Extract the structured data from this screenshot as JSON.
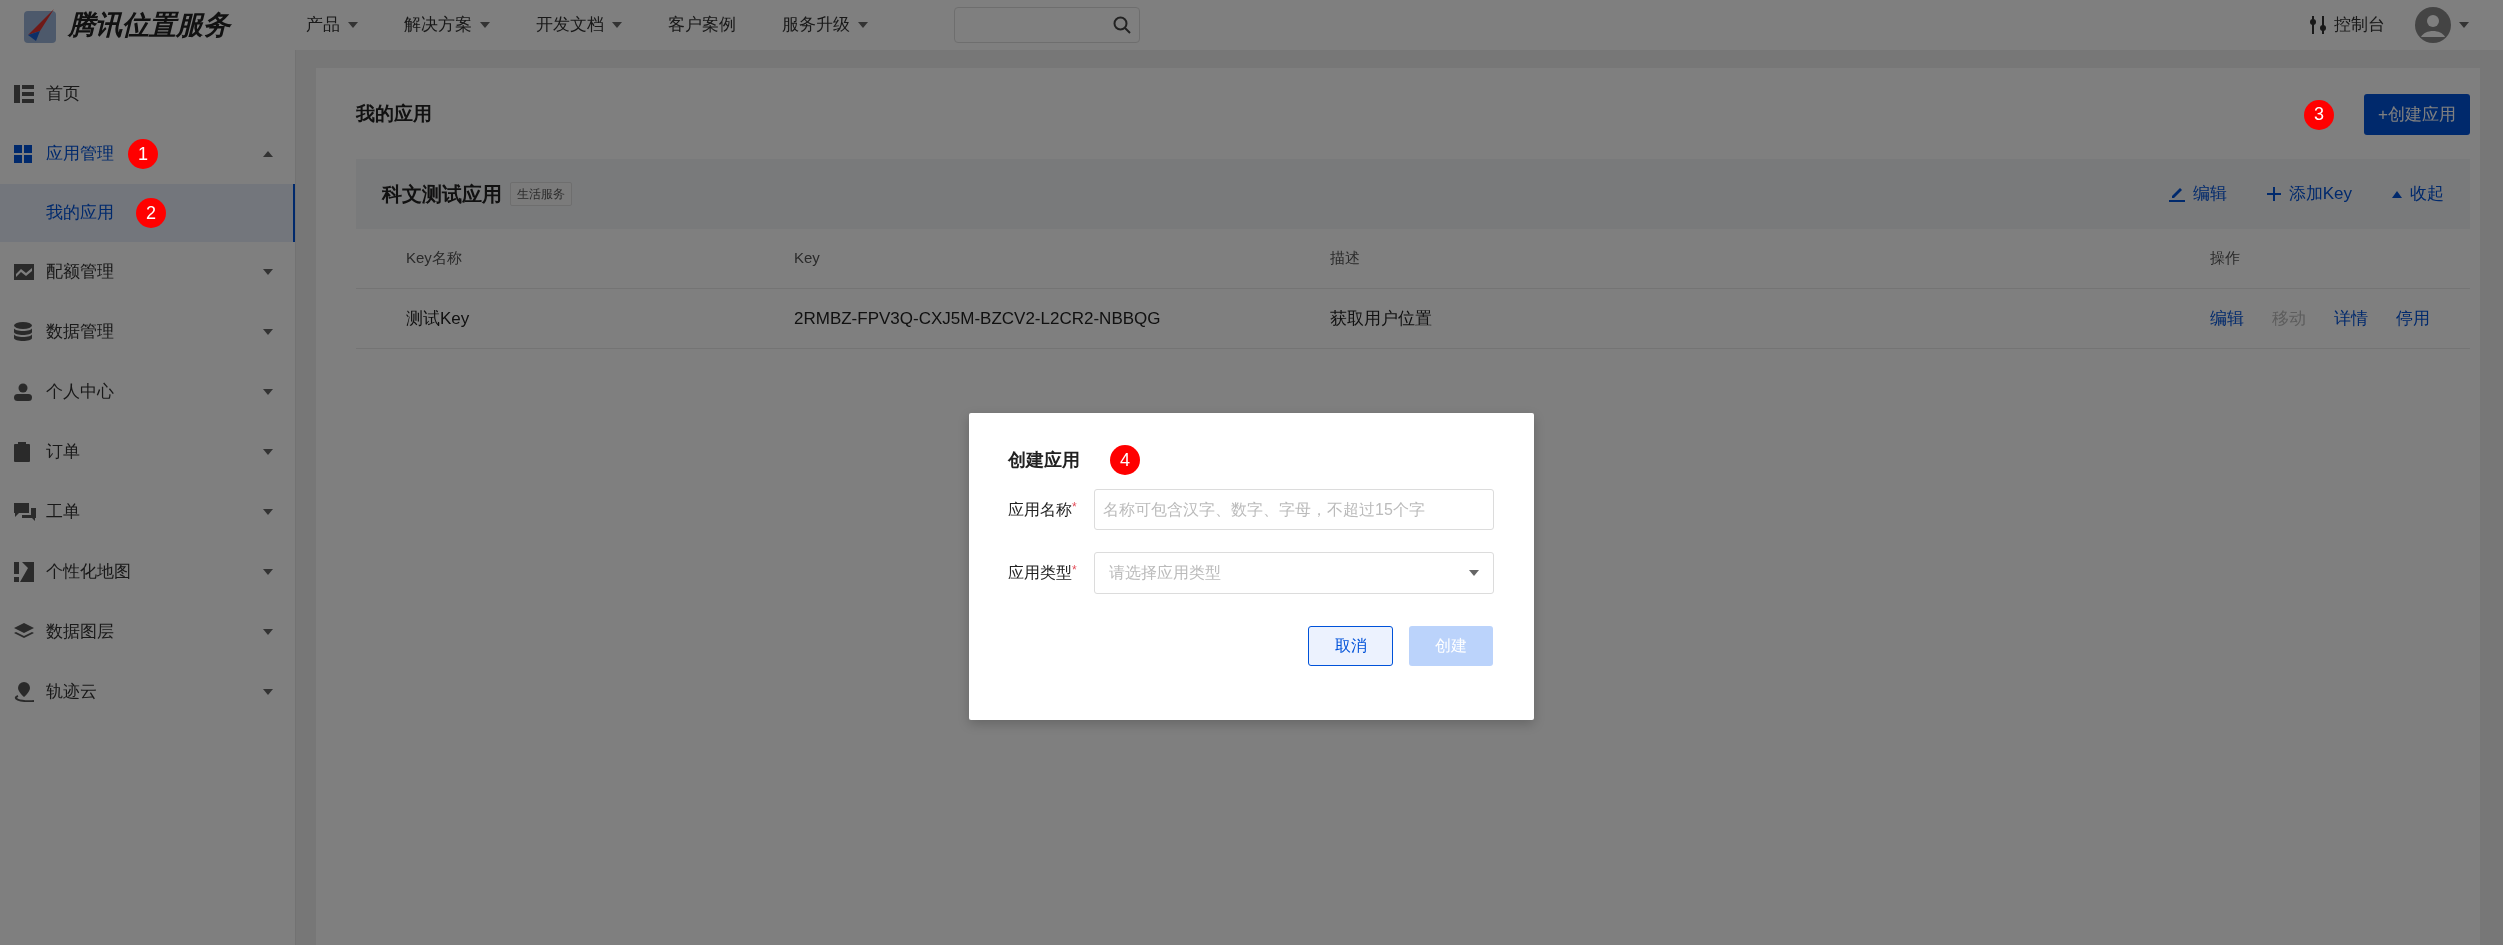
{
  "topbar": {
    "logo_text": "腾讯位置服务",
    "nav": [
      {
        "label": "产品",
        "dropdown": true
      },
      {
        "label": "解决方案",
        "dropdown": true
      },
      {
        "label": "开发文档",
        "dropdown": true
      },
      {
        "label": "客户案例",
        "dropdown": false
      },
      {
        "label": "服务升级",
        "dropdown": true
      }
    ],
    "console_label": "控制台"
  },
  "sidebar": {
    "items": [
      {
        "label": "首页",
        "kind": "home",
        "selected": false
      },
      {
        "label": "应用管理",
        "kind": "grid",
        "expanded": true,
        "selected": false,
        "marker": "1",
        "children": [
          {
            "label": "我的应用",
            "selected": true,
            "marker": "2"
          }
        ]
      },
      {
        "label": "配额管理",
        "kind": "chart",
        "expanded": false,
        "selected": false
      },
      {
        "label": "数据管理",
        "kind": "database",
        "expanded": false,
        "selected": false
      },
      {
        "label": "个人中心",
        "kind": "person",
        "expanded": false,
        "selected": false
      },
      {
        "label": "订单",
        "kind": "clipboard",
        "expanded": false,
        "selected": false
      },
      {
        "label": "工单",
        "kind": "chat",
        "expanded": false,
        "selected": false
      },
      {
        "label": "个性化地图",
        "kind": "map",
        "expanded": false,
        "selected": false
      },
      {
        "label": "数据图层",
        "kind": "layers",
        "expanded": false,
        "selected": false
      },
      {
        "label": "轨迹云",
        "kind": "pin",
        "expanded": false,
        "selected": false
      }
    ]
  },
  "content": {
    "title": "我的应用",
    "create_button": {
      "label": "+创建应用",
      "marker": "3"
    },
    "app": {
      "name": "科文测试应用",
      "tag": "生活服务",
      "expanded": true,
      "actions": [
        {
          "label": "编辑",
          "kind": "pencil"
        },
        {
          "label": "添加Key",
          "kind": "plus"
        },
        {
          "label": "收起",
          "kind": "collapse"
        }
      ]
    },
    "table": {
      "columns": [
        "Key名称",
        "Key",
        "描述",
        "操作"
      ],
      "rows": [
        {
          "cells": [
            "测试Key",
            "2RMBZ-FPV3Q-CXJ5M-BZCV2-L2CR2-NBBQG",
            "获取用户位置"
          ],
          "actions": [
            {
              "label": "编辑",
              "disabled": false
            },
            {
              "label": "移动",
              "disabled": true
            },
            {
              "label": "详情",
              "disabled": false
            },
            {
              "label": "停用",
              "disabled": false
            }
          ]
        }
      ]
    }
  },
  "modal": {
    "title": "创建应用",
    "marker": "4",
    "fields": [
      {
        "label": "应用名称",
        "required_mark": "*",
        "kind": "text",
        "placeholder": "名称可包含汉字、数字、字母，不超过15个字"
      },
      {
        "label": "应用类型",
        "required_mark": "*",
        "kind": "select",
        "placeholder": "请选择应用类型"
      }
    ],
    "buttons": [
      {
        "label": "取消",
        "kind": "secondary",
        "disabled": false
      },
      {
        "label": "创建",
        "kind": "primary",
        "disabled": true
      }
    ]
  }
}
